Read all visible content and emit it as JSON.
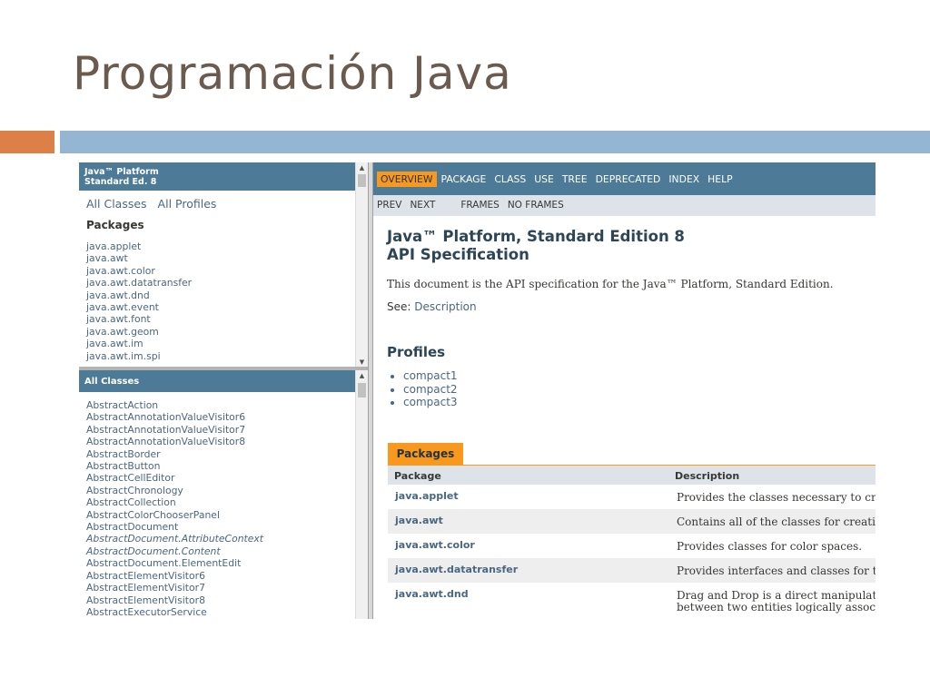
{
  "slide": {
    "title": "Programación Java",
    "colors": {
      "title": "#6b5a4e",
      "band_orange": "#dd8047",
      "band_blue": "#94b6d2"
    }
  },
  "left_top_frame": {
    "header_line1": "Java™ Platform",
    "header_line2": "Standard Ed. 8",
    "links": [
      "All Classes",
      "All Profiles"
    ],
    "packages_heading": "Packages",
    "packages": [
      "java.applet",
      "java.awt",
      "java.awt.color",
      "java.awt.datatransfer",
      "java.awt.dnd",
      "java.awt.event",
      "java.awt.font",
      "java.awt.geom",
      "java.awt.im",
      "java.awt.im.spi"
    ]
  },
  "left_bottom_frame": {
    "header": "All Classes",
    "classes": [
      "AbstractAction",
      "AbstractAnnotationValueVisitor6",
      "AbstractAnnotationValueVisitor7",
      "AbstractAnnotationValueVisitor8",
      "AbstractBorder",
      "AbstractButton",
      "AbstractCellEditor",
      "AbstractChronology",
      "AbstractCollection",
      "AbstractColorChooserPanel",
      "AbstractDocument",
      "AbstractDocument.AttributeContext",
      "AbstractDocument.Content",
      "AbstractDocument.ElementEdit",
      "AbstractElementVisitor6",
      "AbstractElementVisitor7",
      "AbstractElementVisitor8",
      "AbstractExecutorService"
    ],
    "italic_indices": [
      11,
      12
    ]
  },
  "topnav": {
    "items": [
      "OVERVIEW",
      "PACKAGE",
      "CLASS",
      "USE",
      "TREE",
      "DEPRECATED",
      "INDEX",
      "HELP"
    ],
    "active": "OVERVIEW"
  },
  "subnav": {
    "prev": "PREV",
    "next": "NEXT",
    "frames": "FRAMES",
    "no_frames": "NO FRAMES"
  },
  "main": {
    "title_line1": "Java™ Platform, Standard Edition 8",
    "title_line2": "API Specification",
    "description": "This document is the API specification for the Java™ Platform, Standard Edition.",
    "see_label": "See:",
    "see_link": "Description",
    "profiles_heading": "Profiles",
    "profiles": [
      "compact1",
      "compact2",
      "compact3"
    ]
  },
  "packages_table": {
    "caption": "Packages",
    "col_package": "Package",
    "col_description": "Description",
    "rows": [
      {
        "name": "java.applet",
        "description": "Provides the classes necessary to cre"
      },
      {
        "name": "java.awt",
        "description": "Contains all of the classes for creatin"
      },
      {
        "name": "java.awt.color",
        "description": "Provides classes for color spaces."
      },
      {
        "name": "java.awt.datatransfer",
        "description": "Provides interfaces and classes for tr"
      },
      {
        "name": "java.awt.dnd",
        "description": "Drag and Drop is a direct manipulati",
        "description2": "between two entities logically associ"
      }
    ]
  },
  "colors": {
    "nav_blue": "#4d7a97",
    "accent_orange": "#f8981d",
    "link": "#4a6782",
    "subnav_bg": "#dee3e9"
  }
}
